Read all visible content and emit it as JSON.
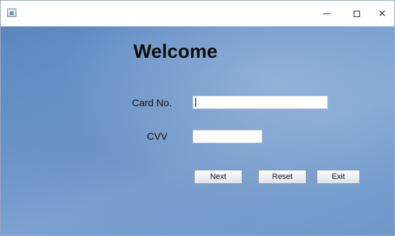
{
  "titlebar": {
    "icon": "java-app-icon",
    "minimize_icon": "minimize-icon",
    "maximize_icon": "maximize-icon",
    "close_glyph": "×"
  },
  "form": {
    "heading": "Welcome",
    "card_label": "Card No.",
    "card_value": "",
    "cvv_label": "CVV",
    "cvv_value": ""
  },
  "buttons": {
    "next": "Next",
    "reset": "Reset",
    "exit": "Exit"
  },
  "colors": {
    "background": "#6d97cb",
    "heading": "#0d0d0d"
  }
}
